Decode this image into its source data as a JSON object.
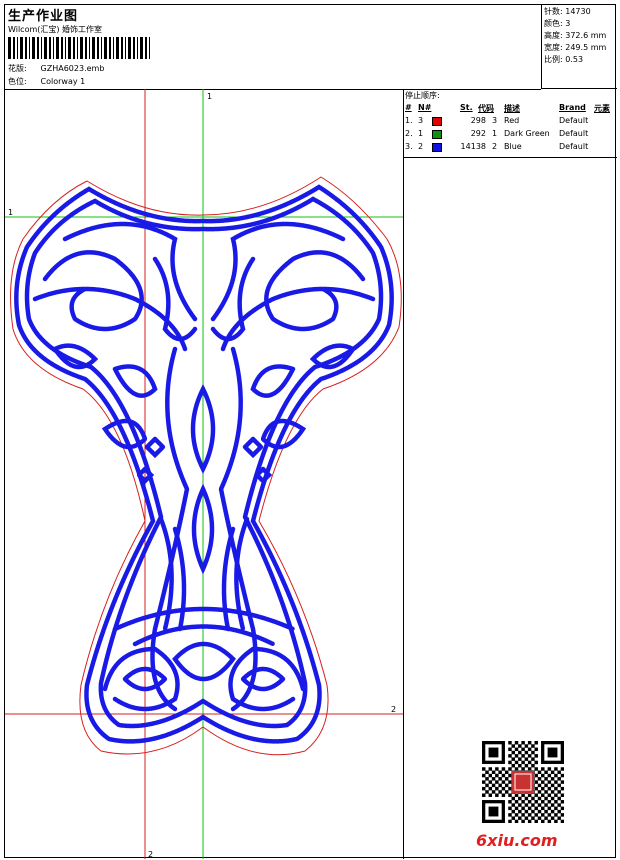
{
  "header": {
    "title": "生产作业图",
    "subtitle": "Wilcom(汇宝) 婚饰工作室",
    "design_label": "花版:",
    "design_value": "GZHA6023.emb",
    "color_label": "色位:",
    "color_value": "Colorway 1"
  },
  "stats": [
    {
      "label": "针数:",
      "value": "14730"
    },
    {
      "label": "颜色:",
      "value": "3"
    },
    {
      "label": "高度:",
      "value": "372.6 mm"
    },
    {
      "label": "宽度:",
      "value": "249.5 mm"
    },
    {
      "label": "比例:",
      "value": "0.53"
    }
  ],
  "canvas": {
    "guide_labels": {
      "top": "1",
      "left": "1",
      "right": "2",
      "bottom": "2"
    },
    "colors": {
      "outline": "#d62020",
      "stitch": "#1a1ae6",
      "guide_green": "#12c012",
      "guide_red": "#d62020"
    }
  },
  "legend": {
    "title": "停止顺序:",
    "headers": {
      "idx": "#",
      "n": "N#",
      "st": "St.",
      "code": "代码",
      "desc": "描述",
      "brand": "Brand",
      "elem": "元素"
    },
    "rows": [
      {
        "idx": "1.",
        "n": "3",
        "color": "#e00000",
        "st": "298",
        "code": "3",
        "desc": "Red",
        "brand": "Default"
      },
      {
        "idx": "2.",
        "n": "1",
        "color": "#109010",
        "st": "292",
        "code": "1",
        "desc": "Dark Green",
        "brand": "Default"
      },
      {
        "idx": "3.",
        "n": "2",
        "color": "#1010e0",
        "st": "14138",
        "code": "2",
        "desc": "Blue",
        "brand": "Default"
      }
    ]
  },
  "watermark": "6xiu.com"
}
